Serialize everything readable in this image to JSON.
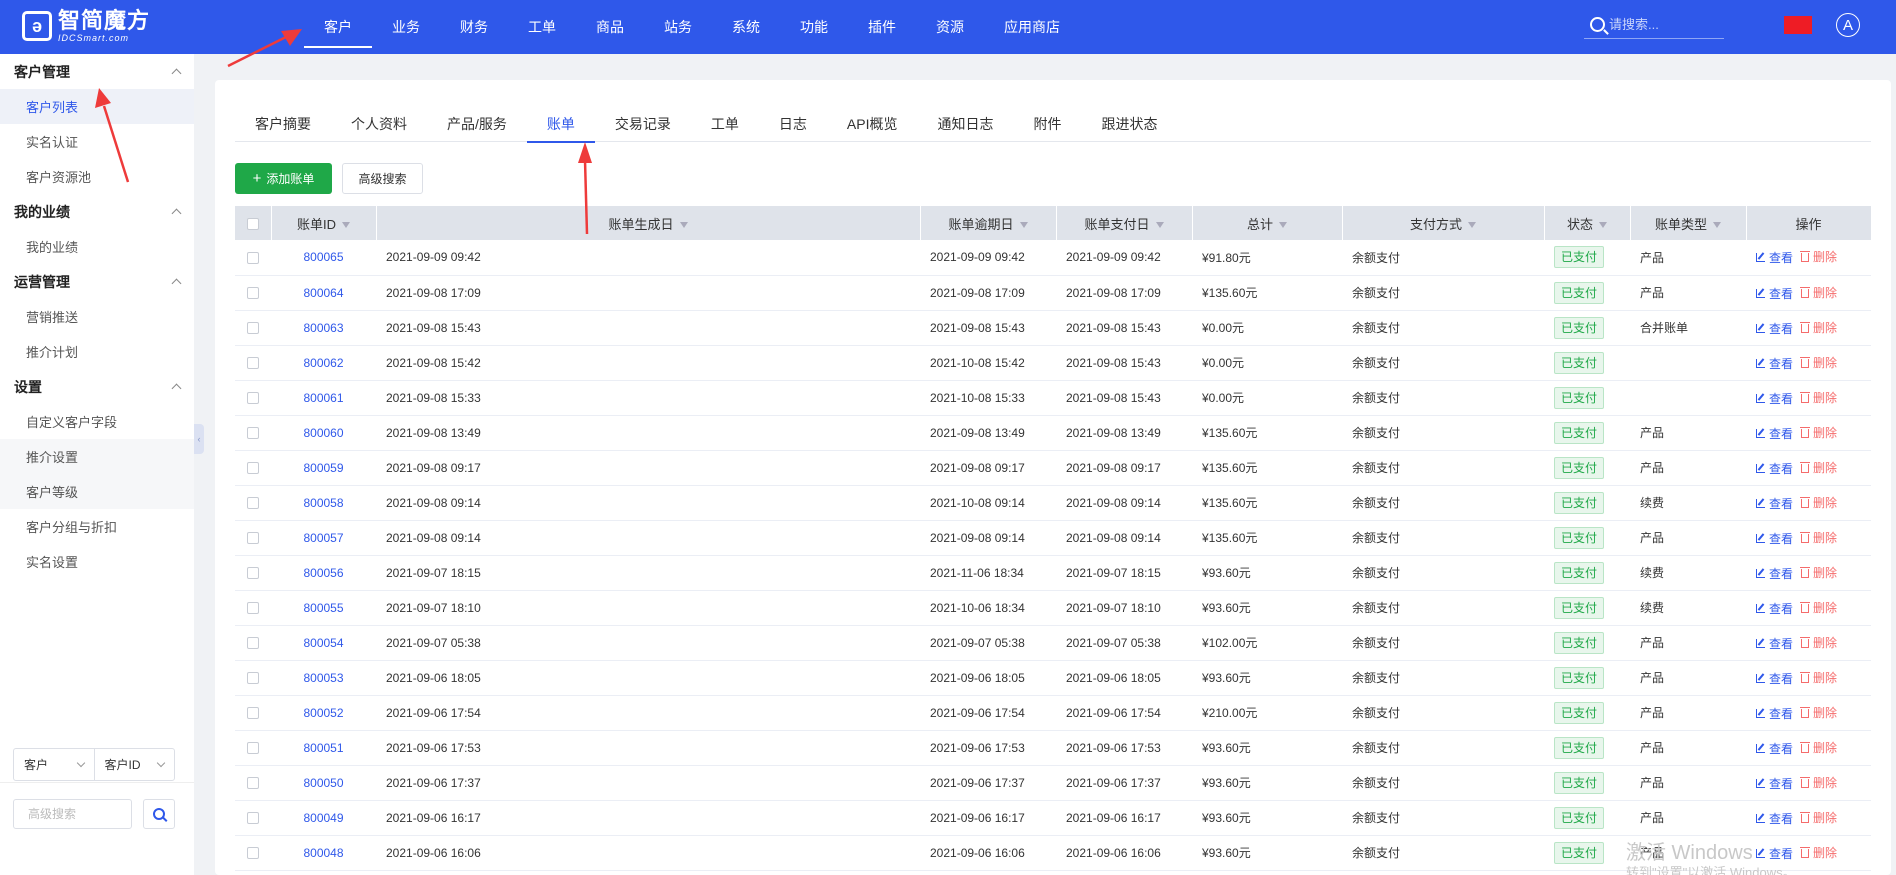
{
  "brand": {
    "cn": "智简魔方",
    "en": "IDCSmart.com"
  },
  "topnav": [
    "客户",
    "业务",
    "财务",
    "工单",
    "商品",
    "站务",
    "系统",
    "功能",
    "插件",
    "资源",
    "应用商店"
  ],
  "top_search_placeholder": "请搜索...",
  "avatar_letter": "A",
  "sidebar": {
    "groups": [
      {
        "title": "客户管理",
        "items": [
          "客户列表",
          "实名认证",
          "客户资源池"
        ]
      },
      {
        "title": "我的业绩",
        "items": [
          "我的业绩"
        ]
      },
      {
        "title": "运营管理",
        "items": [
          "营销推送",
          "推介计划"
        ]
      },
      {
        "title": "设置",
        "items": [
          "自定义客户字段",
          "推介设置",
          "客户等级",
          "客户分组与折扣",
          "实名设置"
        ]
      }
    ],
    "select_1": "客户",
    "select_2": "客户ID",
    "search_placeholder": "高级搜索"
  },
  "tabs": [
    "客户摘要",
    "个人资料",
    "产品/服务",
    "账单",
    "交易记录",
    "工单",
    "日志",
    "API概览",
    "通知日志",
    "附件",
    "跟进状态"
  ],
  "buttons": {
    "add": "添加账单",
    "advanced": "高级搜索"
  },
  "table": {
    "headers": [
      "账单ID",
      "账单生成日",
      "账单逾期日",
      "账单支付日",
      "总计",
      "支付方式",
      "状态",
      "账单类型",
      "操作"
    ],
    "view_label": "查看",
    "delete_label": "删除",
    "rows": [
      [
        "800065",
        "2021-09-09 09:42",
        "2021-09-09 09:42",
        "2021-09-09 09:42",
        "¥91.80元",
        "余额支付",
        "已支付",
        "产品"
      ],
      [
        "800064",
        "2021-09-08 17:09",
        "2021-09-08 17:09",
        "2021-09-08 17:09",
        "¥135.60元",
        "余额支付",
        "已支付",
        "产品"
      ],
      [
        "800063",
        "2021-09-08 15:43",
        "2021-09-08 15:43",
        "2021-09-08 15:43",
        "¥0.00元",
        "余额支付",
        "已支付",
        "合并账单"
      ],
      [
        "800062",
        "2021-09-08 15:42",
        "2021-10-08 15:42",
        "2021-09-08 15:43",
        "¥0.00元",
        "余额支付",
        "已支付",
        ""
      ],
      [
        "800061",
        "2021-09-08 15:33",
        "2021-10-08 15:33",
        "2021-09-08 15:43",
        "¥0.00元",
        "余额支付",
        "已支付",
        ""
      ],
      [
        "800060",
        "2021-09-08 13:49",
        "2021-09-08 13:49",
        "2021-09-08 13:49",
        "¥135.60元",
        "余额支付",
        "已支付",
        "产品"
      ],
      [
        "800059",
        "2021-09-08 09:17",
        "2021-09-08 09:17",
        "2021-09-08 09:17",
        "¥135.60元",
        "余额支付",
        "已支付",
        "产品"
      ],
      [
        "800058",
        "2021-09-08 09:14",
        "2021-10-08 09:14",
        "2021-09-08 09:14",
        "¥135.60元",
        "余额支付",
        "已支付",
        "续费"
      ],
      [
        "800057",
        "2021-09-08 09:14",
        "2021-09-08 09:14",
        "2021-09-08 09:14",
        "¥135.60元",
        "余额支付",
        "已支付",
        "产品"
      ],
      [
        "800056",
        "2021-09-07 18:15",
        "2021-11-06 18:34",
        "2021-09-07 18:15",
        "¥93.60元",
        "余额支付",
        "已支付",
        "续费"
      ],
      [
        "800055",
        "2021-09-07 18:10",
        "2021-10-06 18:34",
        "2021-09-07 18:10",
        "¥93.60元",
        "余额支付",
        "已支付",
        "续费"
      ],
      [
        "800054",
        "2021-09-07 05:38",
        "2021-09-07 05:38",
        "2021-09-07 05:38",
        "¥102.00元",
        "余额支付",
        "已支付",
        "产品"
      ],
      [
        "800053",
        "2021-09-06 18:05",
        "2021-09-06 18:05",
        "2021-09-06 18:05",
        "¥93.60元",
        "余额支付",
        "已支付",
        "产品"
      ],
      [
        "800052",
        "2021-09-06 17:54",
        "2021-09-06 17:54",
        "2021-09-06 17:54",
        "¥210.00元",
        "余额支付",
        "已支付",
        "产品"
      ],
      [
        "800051",
        "2021-09-06 17:53",
        "2021-09-06 17:53",
        "2021-09-06 17:53",
        "¥93.60元",
        "余额支付",
        "已支付",
        "产品"
      ],
      [
        "800050",
        "2021-09-06 17:37",
        "2021-09-06 17:37",
        "2021-09-06 17:37",
        "¥93.60元",
        "余额支付",
        "已支付",
        "产品"
      ],
      [
        "800049",
        "2021-09-06 16:17",
        "2021-09-06 16:17",
        "2021-09-06 16:17",
        "¥93.60元",
        "余额支付",
        "已支付",
        "产品"
      ],
      [
        "800048",
        "2021-09-06 16:06",
        "2021-09-06 16:06",
        "2021-09-06 16:06",
        "¥93.60元",
        "余额支付",
        "已支付",
        "产品"
      ]
    ]
  },
  "watermark": {
    "line1": "激活 Windows",
    "line2": "转到\"设置\"以激活 Windows。"
  },
  "colors": {
    "primary": "#2f58ea",
    "success": "#1fa848",
    "danger": "#f56c6c",
    "annotation": "#ee3b3b"
  }
}
